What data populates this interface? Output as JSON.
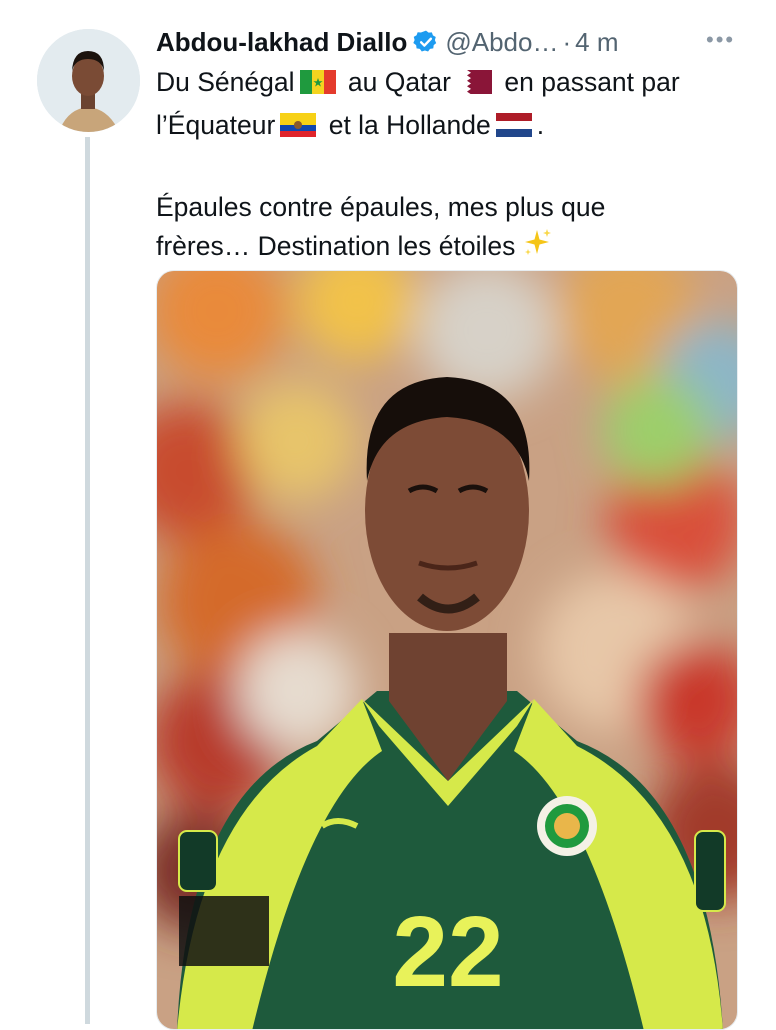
{
  "tweet": {
    "author_name": "Abdou-lakhad Diallo",
    "handle": "@Abdo…",
    "dot": "·",
    "time": "4 m",
    "more_icon": "more-horizontal-icon",
    "verified_icon": "verified-badge-icon",
    "text": {
      "l1a": "Du Sénégal",
      "l1b": "au Qatar",
      "l1c": "en passant par",
      "l2a": "l’Équateur",
      "l2b": "et la Hollande",
      "l2c": ".",
      "l3": "Épaules contre épaules, mes plus que",
      "l4": "frères… Destination les étoiles"
    },
    "media": {
      "jersey_number": "22"
    }
  },
  "colors": {
    "verified": "#1d9bf0",
    "thread_line": "#cfd9de",
    "jersey_green": "#1e5a3c",
    "jersey_yellow": "#d6e94a"
  }
}
